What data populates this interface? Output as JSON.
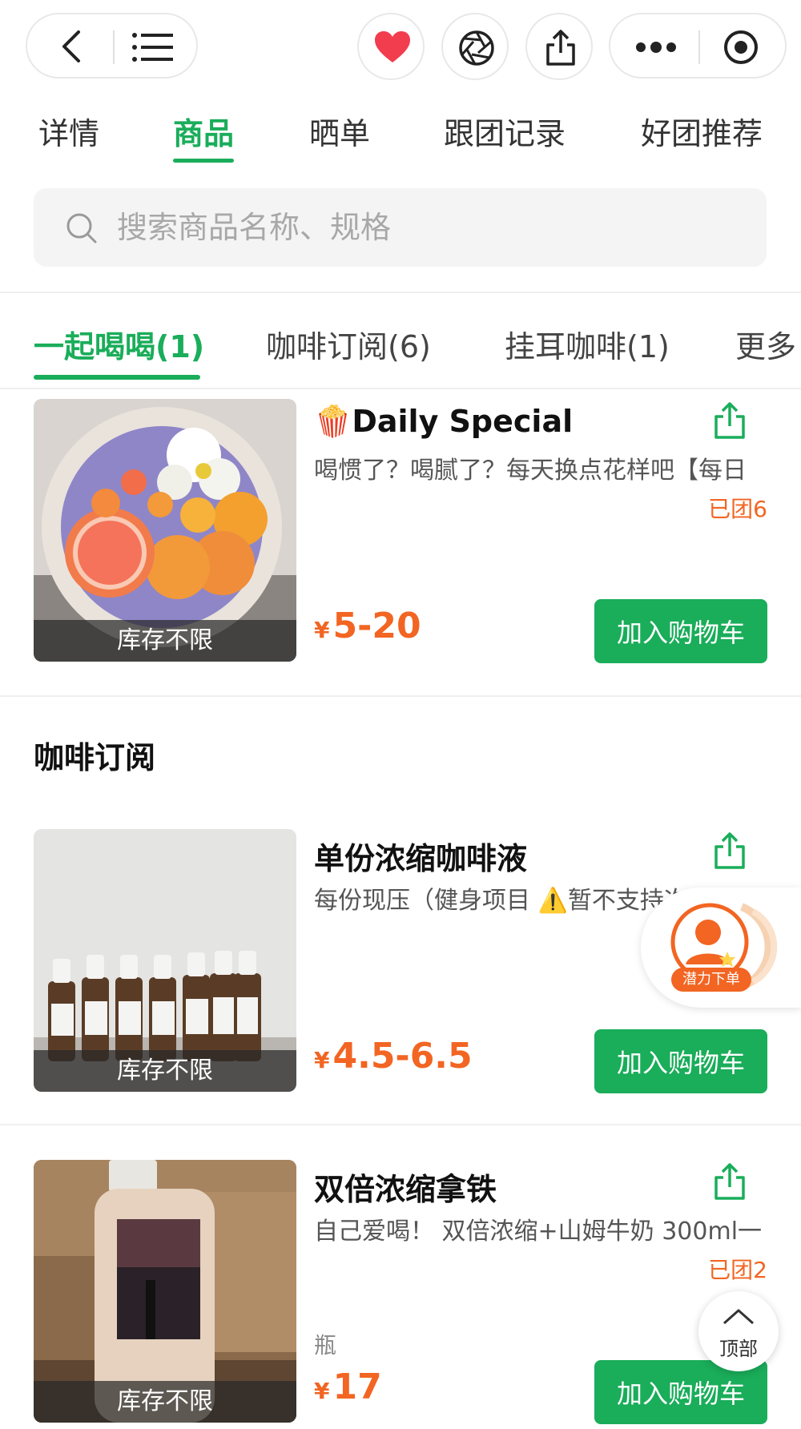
{
  "header": {
    "icons": [
      "back-icon",
      "menu-icon",
      "heart-icon",
      "aperture-icon",
      "share-icon",
      "more-icon",
      "record-icon"
    ],
    "colors": {
      "heart": "#f23d4f",
      "accent": "#1aad5a",
      "price": "#f26522"
    }
  },
  "main_tabs": [
    "详情",
    "商品",
    "晒单",
    "跟团记录",
    "好团推荐"
  ],
  "main_tab_active": "商品",
  "search": {
    "placeholder": "搜索商品名称、规格"
  },
  "category_tabs": [
    "一起喝喝(1)",
    "咖啡订阅(6)",
    "挂耳咖啡(1)",
    "更多"
  ],
  "section_title": "咖啡订阅",
  "products": [
    {
      "title": "Daily Special",
      "title_emoji": "🍿",
      "desc": "喝惯了？喝腻了？每天换点花样吧【每日",
      "tuan": "已团6",
      "price_symbol": "¥",
      "price": "5-20",
      "stock": "库存不限",
      "button": "加入购物车"
    },
    {
      "title": "单份浓缩咖啡液",
      "desc": "每份现压（健身项目 ⚠️暂不支持次日上",
      "price_symbol": "¥",
      "price": "4.5-6.5",
      "stock": "库存不限",
      "button": "加入购物车"
    },
    {
      "title": "双倍浓缩拿铁",
      "desc": "自己爱喝！ 双倍浓缩+山姆牛奶 300ml一",
      "tuan": "已团2",
      "unit": "瓶",
      "price_symbol": "¥",
      "price": "17",
      "stock": "库存不限",
      "button": "加入购物车"
    }
  ],
  "floating": {
    "order_label": "潜力下单",
    "top_label": "顶部"
  }
}
